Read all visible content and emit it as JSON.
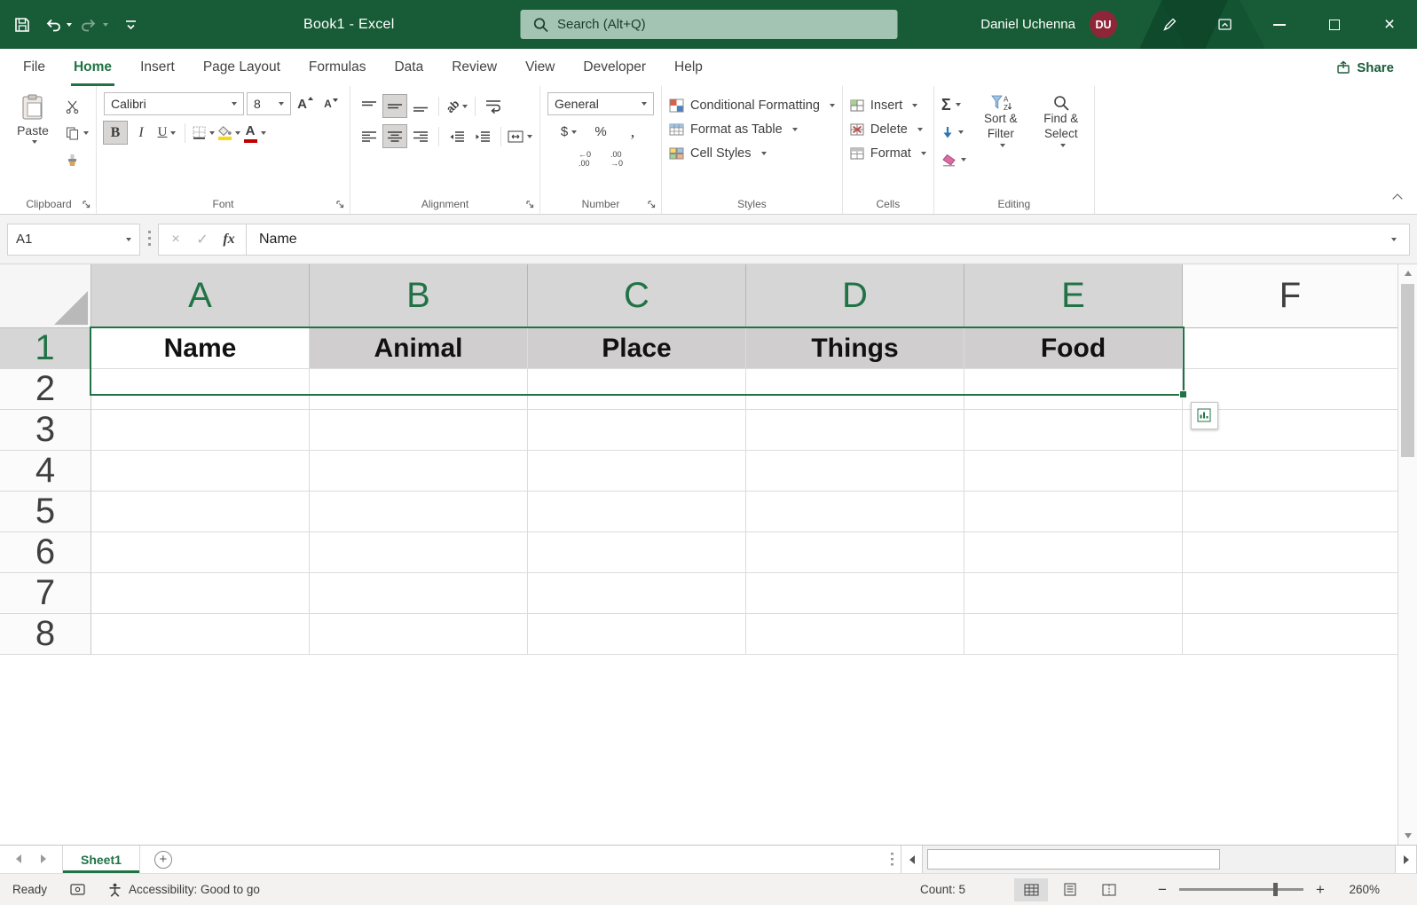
{
  "titlebar": {
    "title": "Book1 - Excel",
    "search_placeholder": "Search (Alt+Q)",
    "user_name": "Daniel Uchenna",
    "user_initials": "DU"
  },
  "tabs": {
    "items": [
      {
        "label": "File"
      },
      {
        "label": "Home"
      },
      {
        "label": "Insert"
      },
      {
        "label": "Page Layout"
      },
      {
        "label": "Formulas"
      },
      {
        "label": "Data"
      },
      {
        "label": "Review"
      },
      {
        "label": "View"
      },
      {
        "label": "Developer"
      },
      {
        "label": "Help"
      }
    ],
    "active_tab": "Home",
    "share_label": "Share"
  },
  "ribbon": {
    "clipboard": {
      "group_label": "Clipboard",
      "paste_label": "Paste"
    },
    "font": {
      "group_label": "Font",
      "font_name": "Calibri",
      "font_size": "8"
    },
    "alignment": {
      "group_label": "Alignment"
    },
    "number": {
      "group_label": "Number",
      "number_format": "General"
    },
    "styles": {
      "group_label": "Styles",
      "conditional_formatting": "Conditional Formatting",
      "format_as_table": "Format as Table",
      "cell_styles": "Cell Styles"
    },
    "cells": {
      "group_label": "Cells",
      "insert": "Insert",
      "delete": "Delete",
      "format": "Format"
    },
    "editing": {
      "group_label": "Editing",
      "sort_filter": "Sort & Filter",
      "find_select": "Find & Select"
    }
  },
  "formula_bar": {
    "name_box": "A1",
    "formula": "Name"
  },
  "grid": {
    "columns": [
      "A",
      "B",
      "C",
      "D",
      "E",
      "F"
    ],
    "rows": [
      "1",
      "2",
      "3",
      "4",
      "5",
      "6",
      "7",
      "8"
    ],
    "values": {
      "1": {
        "A": "Name",
        "B": "Animal",
        "C": "Place",
        "D": "Things",
        "E": "Food"
      }
    },
    "selection": {
      "range": "A1:E1",
      "active_cell": "A1",
      "selected_columns": [
        "A",
        "B",
        "C",
        "D",
        "E"
      ],
      "selected_rows": [
        "1"
      ]
    }
  },
  "sheet_bar": {
    "sheet_name": "Sheet1"
  },
  "status_bar": {
    "mode": "Ready",
    "accessibility": "Accessibility: Good to go",
    "count": "Count: 5",
    "zoom_level": "260%"
  },
  "icons": {
    "bold": "B",
    "italic": "I",
    "underline": "U",
    "letter_a": "A",
    "sum": "Σ",
    "fx": "fx",
    "cancel": "×",
    "enter": "✓",
    "dollar": "$",
    "percent": "%",
    "comma": ",",
    "inc_decimal": [
      "←0",
      ".00"
    ],
    "dec_decimal": [
      ".00",
      "→0"
    ],
    "orientation_ab": "ab",
    "add_sheet": "+",
    "zoom_out": "−",
    "zoom_in": "+"
  },
  "colors": {
    "title_green": "#185C37",
    "accent_green": "#217346",
    "selected_cell_gray": "#D0CECE",
    "avatar_maroon": "#8E2638",
    "fill_color_bar": "#F7D917",
    "font_color_bar": "#C00000"
  }
}
